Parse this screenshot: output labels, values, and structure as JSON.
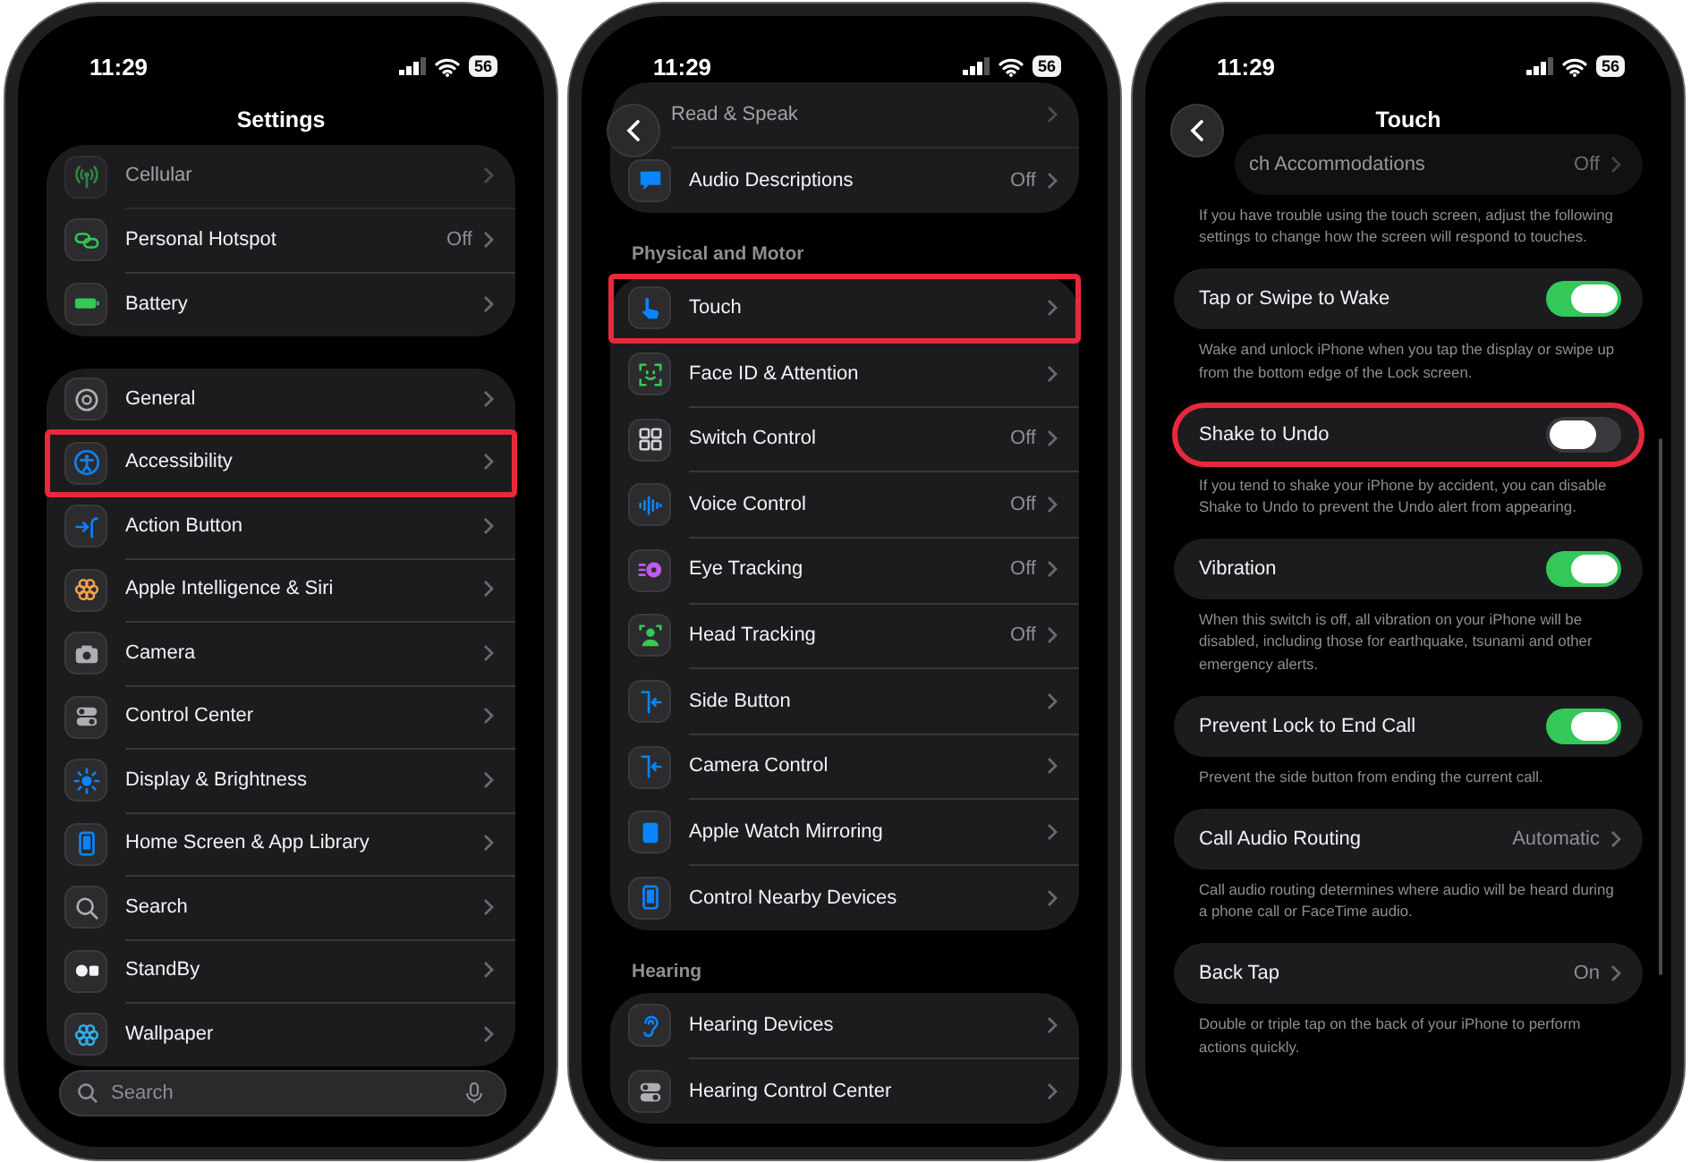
{
  "phones": [
    {
      "kind": "list",
      "time": "11:29",
      "battery": "56",
      "title": "Settings",
      "back": false,
      "groups": [
        {
          "rows": [
            {
              "label": "Cellular",
              "dimmed": true,
              "highlighted": false
            },
            {
              "label": "Personal Hotspot",
              "value": "Off",
              "dimmed": false,
              "highlighted": false
            },
            {
              "label": "Battery",
              "dimmed": false,
              "highlighted": false
            }
          ]
        },
        {
          "rows": [
            {
              "label": "General",
              "dimmed": false,
              "highlighted": false
            },
            {
              "label": "Accessibility",
              "dimmed": false,
              "highlighted": true
            },
            {
              "label": "Action Button",
              "dimmed": false,
              "highlighted": false
            },
            {
              "label": "Apple Intelligence & Siri",
              "dimmed": false,
              "highlighted": false
            },
            {
              "label": "Camera",
              "dimmed": false,
              "highlighted": false
            },
            {
              "label": "Control Center",
              "dimmed": false,
              "highlighted": false
            },
            {
              "label": "Display & Brightness",
              "dimmed": false,
              "highlighted": false
            },
            {
              "label": "Home Screen & App Library",
              "dimmed": false,
              "highlighted": false
            },
            {
              "label": "Search",
              "dimmed": false,
              "highlighted": false
            },
            {
              "label": "StandBy",
              "dimmed": false,
              "highlighted": false
            },
            {
              "label": "Wallpaper",
              "dimmed": false,
              "highlighted": false
            }
          ]
        }
      ],
      "search": {
        "placeholder": "Search"
      }
    },
    {
      "kind": "list",
      "time": "11:29",
      "battery": "56",
      "back": true,
      "groups": [
        {
          "rows": [
            {
              "label": "Read & Speak",
              "dimmed": true,
              "highlighted": false
            },
            {
              "label": "Audio Descriptions",
              "value": "Off",
              "dimmed": false,
              "highlighted": false
            }
          ]
        },
        {
          "header": "Physical and Motor",
          "rows": [
            {
              "label": "Touch",
              "dimmed": false,
              "highlighted": true
            },
            {
              "label": "Face ID & Attention",
              "dimmed": false,
              "highlighted": false
            },
            {
              "label": "Switch Control",
              "value": "Off",
              "dimmed": false,
              "highlighted": false
            },
            {
              "label": "Voice Control",
              "value": "Off",
              "dimmed": false,
              "highlighted": false
            },
            {
              "label": "Eye Tracking",
              "value": "Off",
              "dimmed": false,
              "highlighted": false
            },
            {
              "label": "Head Tracking",
              "value": "Off",
              "dimmed": false,
              "highlighted": false
            },
            {
              "label": "Side Button",
              "dimmed": false,
              "highlighted": false
            },
            {
              "label": "Camera Control",
              "dimmed": false,
              "highlighted": false
            },
            {
              "label": "Apple Watch Mirroring",
              "dimmed": false,
              "highlighted": false
            },
            {
              "label": "Control Nearby Devices",
              "dimmed": false,
              "highlighted": false
            }
          ]
        },
        {
          "header": "Hearing",
          "rows": [
            {
              "label": "Hearing Devices",
              "dimmed": false,
              "highlighted": false
            },
            {
              "label": "Hearing Control Center",
              "dimmed": false,
              "highlighted": false
            }
          ]
        }
      ]
    },
    {
      "kind": "cards",
      "time": "11:29",
      "battery": "56",
      "title": "Touch",
      "back": true,
      "sections": [
        {
          "kind": "link",
          "label": "ch Accommodations",
          "value": "Off",
          "dimmed": true,
          "highlighted": false,
          "footer": "If you have trouble using the touch screen, adjust the following settings to change how the screen will respond to touches."
        },
        {
          "kind": "switch",
          "label": "Tap or Swipe to Wake",
          "on": true,
          "dimmed": false,
          "highlighted": false,
          "footer": "Wake and unlock iPhone when you tap the display or swipe up from the bottom edge of the Lock screen."
        },
        {
          "kind": "switch",
          "label": "Shake to Undo",
          "on": false,
          "dimmed": false,
          "highlighted": true,
          "footer": "If you tend to shake your iPhone by accident, you can disable Shake to Undo to prevent the Undo alert from appearing."
        },
        {
          "kind": "switch",
          "label": "Vibration",
          "on": true,
          "dimmed": false,
          "highlighted": false,
          "footer": "When this switch is off, all vibration on your iPhone will be disabled, including those for earthquake, tsunami and other emergency alerts."
        },
        {
          "kind": "switch",
          "label": "Prevent Lock to End Call",
          "on": true,
          "dimmed": false,
          "highlighted": false,
          "footer": "Prevent the side button from ending the current call."
        },
        {
          "kind": "link",
          "label": "Call Audio Routing",
          "value": "Automatic",
          "dimmed": false,
          "highlighted": false,
          "footer": "Call audio routing determines where audio will be heard during a phone call or FaceTime audio."
        },
        {
          "kind": "link",
          "label": "Back Tap",
          "value": "On",
          "dimmed": false,
          "highlighted": false,
          "footer": "Double or triple tap on the back of your iPhone to perform actions quickly."
        }
      ]
    }
  ]
}
